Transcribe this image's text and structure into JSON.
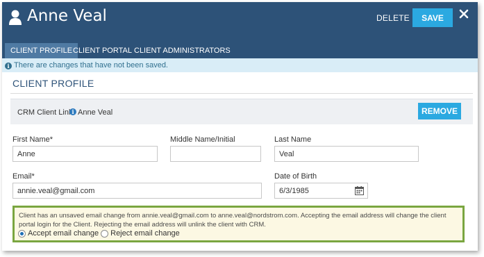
{
  "header": {
    "title": "Anne Veal",
    "delete_label": "DELETE",
    "save_label": "SAVE",
    "colors": {
      "bar": "#2d5278",
      "accent": "#2ba9e1"
    }
  },
  "tabs": [
    {
      "label": "CLIENT PROFILE",
      "active": true
    },
    {
      "label": "CLIENT PORTAL",
      "active": false
    },
    {
      "label": "CLIENT ADMINISTRATORS",
      "active": false
    }
  ],
  "banner": {
    "text": "There are changes that have not been saved."
  },
  "section": {
    "title": "CLIENT PROFILE"
  },
  "crm": {
    "label": "CRM Client Link",
    "name": "Anne Veal",
    "remove_label": "REMOVE"
  },
  "form": {
    "first_name": {
      "label": "First Name*",
      "value": "Anne"
    },
    "middle_name": {
      "label": "Middle Name/Initial",
      "value": ""
    },
    "last_name": {
      "label": "Last Name",
      "value": "Veal"
    },
    "email": {
      "label": "Email*",
      "value": "annie.veal@gmail.com"
    },
    "dob": {
      "label": "Date of Birth",
      "value": "6/3/1985"
    }
  },
  "notice": {
    "text": "Client has an unsaved email change from annie.veal@gmail.com to anne.veal@nordstrom.com. Accepting the email address will change the client portal login for the Client. Rejecting the email address will unlink the client with CRM.",
    "accept_label": "Accept email change",
    "reject_label": "Reject email change",
    "selected": "accept",
    "border_color": "#7aa640"
  },
  "icons": [
    "user-icon",
    "close-icon",
    "info-icon",
    "calendar-icon"
  ]
}
